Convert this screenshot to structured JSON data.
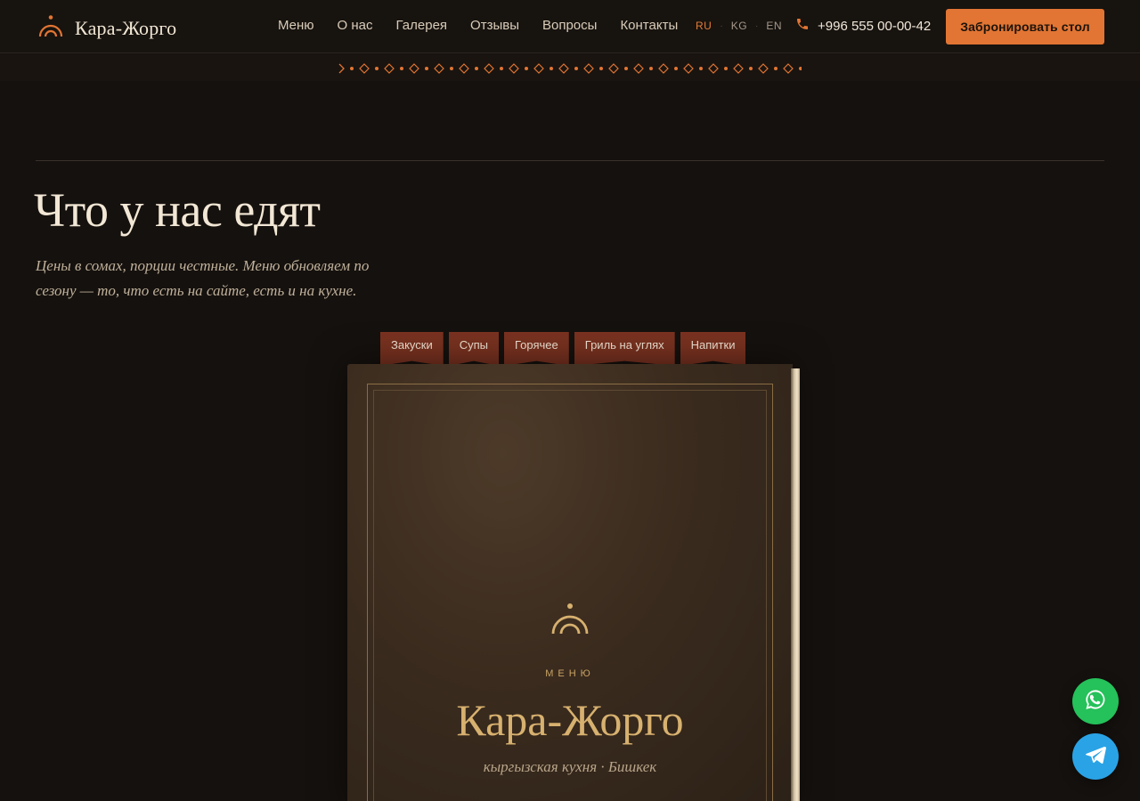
{
  "brand": {
    "name": "Кара-Жорго"
  },
  "nav": {
    "items": [
      {
        "label": "Меню"
      },
      {
        "label": "О нас"
      },
      {
        "label": "Галерея"
      },
      {
        "label": "Отзывы"
      },
      {
        "label": "Вопросы"
      },
      {
        "label": "Контакты"
      }
    ]
  },
  "languages": {
    "ru": "RU",
    "kg": "KG",
    "en": "EN",
    "active": "RU",
    "separator": "·"
  },
  "contact": {
    "phone": "+996 555 00-00-42"
  },
  "header": {
    "book_button": "Забронировать стол"
  },
  "menu_section": {
    "title": "Что у нас едят",
    "subtitle": "Цены в сомах, порции честные. Меню обновляем по сезону — то, что есть на сайте, есть и на кухне.",
    "tabs": [
      {
        "label": "Закуски"
      },
      {
        "label": "Супы"
      },
      {
        "label": "Горячее"
      },
      {
        "label": "Гриль на углях"
      },
      {
        "label": "Напитки"
      }
    ],
    "book": {
      "label": "МЕНЮ",
      "title": "Кара-Жорго",
      "subtitle": "кыргызская кухня · Бишкек"
    }
  },
  "colors": {
    "accent": "#e27533",
    "background": "#15110e",
    "tab": "#7a3220",
    "gold": "#d7b16f",
    "whatsapp": "#25c15a",
    "telegram": "#2aa3e6"
  },
  "icons": {
    "logo": "arch-logo-icon",
    "phone": "phone-icon",
    "whatsapp": "whatsapp-icon",
    "telegram": "telegram-icon"
  }
}
